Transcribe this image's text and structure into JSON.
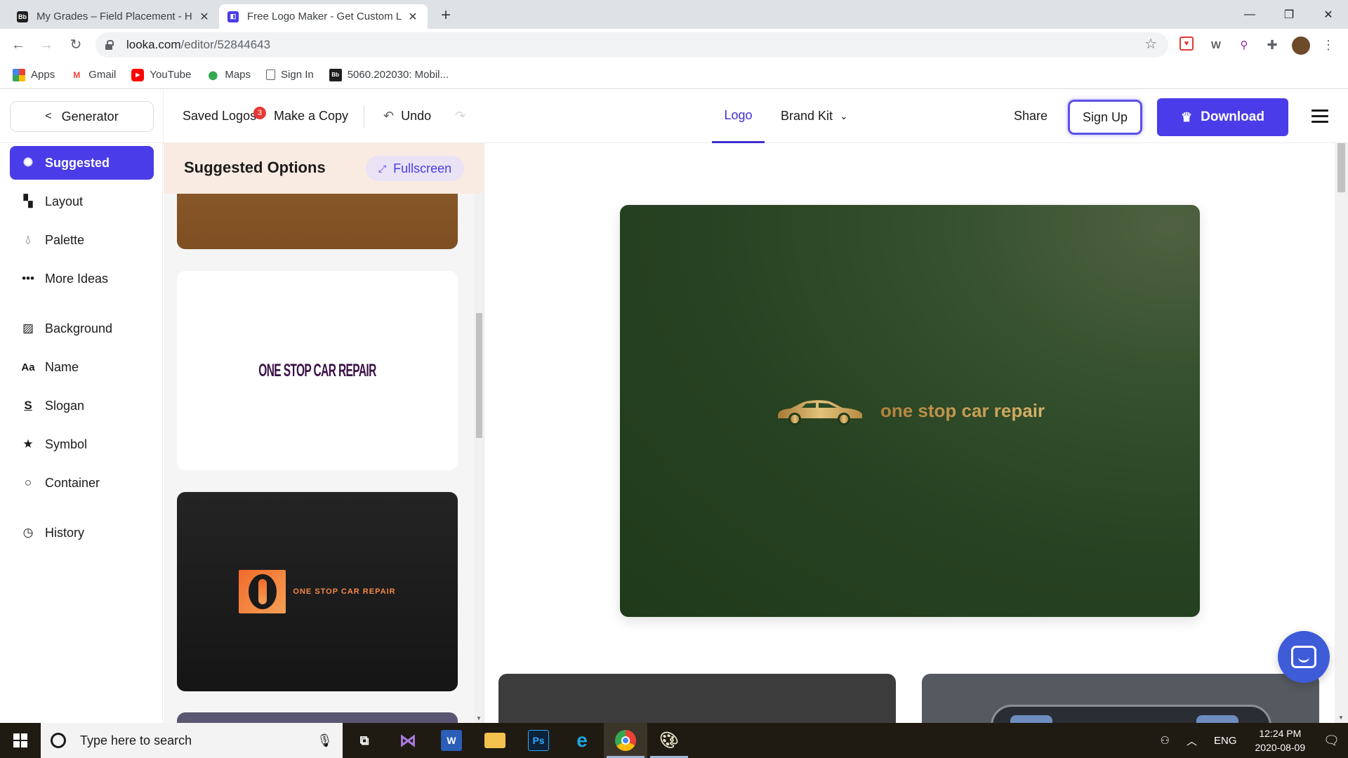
{
  "browser": {
    "tabs": [
      {
        "title": "My Grades – Field Placement - H",
        "favicon": "Bb"
      },
      {
        "title": "Free Logo Maker - Get Custom L",
        "favicon": "looka"
      }
    ],
    "url_host": "looka.com",
    "url_path": "/editor/52844643",
    "bookmarks": [
      {
        "label": "Apps",
        "icon": "apps-grid-icon"
      },
      {
        "label": "Gmail",
        "icon": "gmail-icon"
      },
      {
        "label": "YouTube",
        "icon": "youtube-icon"
      },
      {
        "label": "Maps",
        "icon": "maps-pin-icon"
      },
      {
        "label": "Sign In",
        "icon": "page-icon"
      },
      {
        "label": "5060.202030: Mobil...",
        "icon": "blackboard-icon"
      }
    ]
  },
  "header": {
    "generator_label": "Generator",
    "saved_logos_label": "Saved Logos",
    "saved_logos_count": "3",
    "make_copy_label": "Make a Copy",
    "undo_label": "Undo",
    "tab_logo": "Logo",
    "tab_brand_kit": "Brand Kit",
    "share_label": "Share",
    "signup_label": "Sign Up",
    "download_label": "Download"
  },
  "sidebar": {
    "items": [
      {
        "label": "Suggested",
        "icon": "lightbulb-icon",
        "active": true
      },
      {
        "label": "Layout",
        "icon": "layout-icon"
      },
      {
        "label": "Palette",
        "icon": "droplet-icon"
      },
      {
        "label": "More Ideas",
        "icon": "more-dots-icon"
      },
      {
        "label": "Background",
        "icon": "background-hatch-icon"
      },
      {
        "label": "Name",
        "icon": "font-aa-icon"
      },
      {
        "label": "Slogan",
        "icon": "slogan-s-icon"
      },
      {
        "label": "Symbol",
        "icon": "star-icon"
      },
      {
        "label": "Container",
        "icon": "circle-icon"
      },
      {
        "label": "History",
        "icon": "clock-icon"
      }
    ]
  },
  "panel": {
    "title": "Suggested Options",
    "fullscreen_label": "Fullscreen",
    "card2_text": "ONE STOP CAR REPAIR",
    "card3_text": "ONE STOP CAR REPAIR",
    "card3_mark": "O"
  },
  "canvas": {
    "logo_text": "one stop car repair",
    "background_color": "#274222",
    "text_color": "#c3964a"
  },
  "taskbar": {
    "search_placeholder": "Type here to search",
    "language": "ENG",
    "time": "12:24 PM",
    "date": "2020-08-09"
  }
}
